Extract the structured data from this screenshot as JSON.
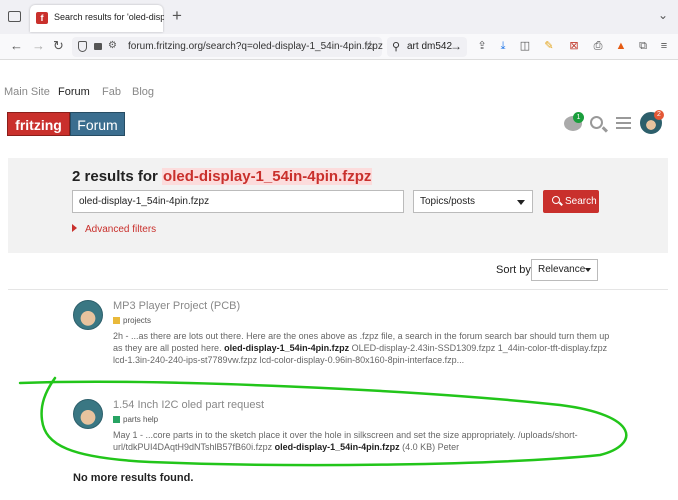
{
  "browser": {
    "tab_title": "Search results for 'oled-display",
    "new_tab": "+",
    "url_scheme_icon": "permissions-icon",
    "url": "forum.fritzing.org/search?q=oled-display-1_54in-4pin.fzpz",
    "find_text": "art dm542"
  },
  "site_nav": {
    "items": [
      "Main Site",
      "Forum",
      "Fab",
      "Blog"
    ]
  },
  "logo": {
    "left": "fritzing",
    "right": "Forum"
  },
  "header": {
    "chat_badge": "1",
    "avatar_badge": "2"
  },
  "search": {
    "results_prefix": "2 results for",
    "query": "oled-display-1_54in-4pin.fzpz",
    "input_value": "oled-display-1_54in-4pin.fzpz",
    "type_value": "Topics/posts",
    "button_label": "Search",
    "advanced_filters": "Advanced filters"
  },
  "sort": {
    "label": "Sort by",
    "value": "Relevance"
  },
  "results": [
    {
      "title": "MP3 Player Project (PCB)",
      "category": "projects",
      "category_color": "#e9b93a",
      "blurb_before": "2h - ...as there are lots out there. Here are the ones above as .fzpz file, a search in the forum search bar should turn them up as they are all posted here.",
      "blurb_match": "oled-display-1_54in-4pin.fzpz",
      "blurb_after": "OLED-display-2.43in-SSD1309.fzpz 1_44in-color-tft-display.fzpz lcd-1.3in-240-240-ips-st7789vw.fzpz lcd-color-display-0.96in-80x160-8pin-interface.fzp..."
    },
    {
      "title": "1.54 Inch I2C oled part request",
      "category": "parts help",
      "category_color": "#27a363",
      "blurb_before": "May 1 - ...core parts in to the sketch place it over the hole in silkscreen and set the size appropriately. /uploads/short-url/tdkPUI4DAqtH9dNTshlB57fB60i.fzpz",
      "blurb_match": "oled-display-1_54in-4pin.fzpz",
      "blurb_after": "(4.0 KB) Peter"
    }
  ],
  "footer": {
    "no_more": "No more results found."
  },
  "colors": {
    "brand_red": "#c9302c",
    "brand_blue": "#3b6e8f",
    "annotation_green": "#22c51a"
  }
}
